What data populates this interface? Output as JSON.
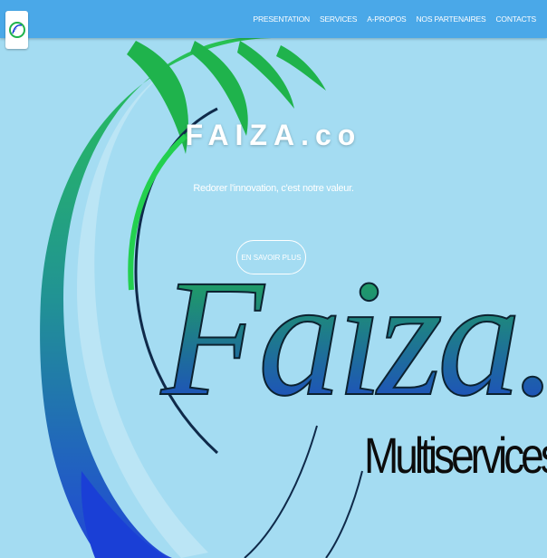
{
  "header": {
    "logo_icon": "faiza-logo",
    "nav_items": [
      "PRESENTATION",
      "SERVICES",
      "A-PROPOS",
      "NOS PARTENAIRES",
      "CONTACTS"
    ]
  },
  "hero": {
    "title": "FAIZA.co",
    "tagline": "Redorer l'innovation, c'est notre valeur.",
    "cta_label": "EN SAVOIR PLUS",
    "brand_text": "Faiza.Co",
    "brand_subtext": "Multiservices"
  },
  "colors": {
    "nav_background": "#4aa8e8",
    "page_background": "#a4dcf2",
    "swirl_green": "#22c24a",
    "swirl_blue": "#1a3fd6"
  }
}
